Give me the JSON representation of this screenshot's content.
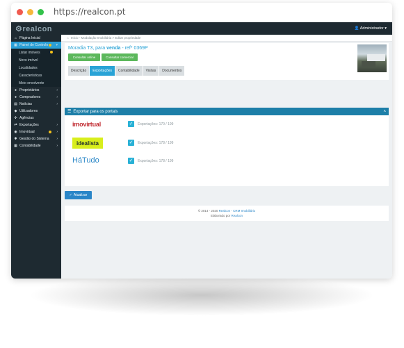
{
  "browser": {
    "url": "https://realcon.pt",
    "dots": [
      "#f05a4f",
      "#f6b73c",
      "#33c24a"
    ]
  },
  "app": {
    "logo": "realcon",
    "user": "Administrador",
    "sidebar": [
      {
        "label": "Página Inicial",
        "icon": "home-icon",
        "type": "item"
      },
      {
        "label": "Painel de Controlo",
        "icon": "dashboard-icon",
        "type": "item",
        "active": true,
        "dot": true
      },
      {
        "label": "Listar imóveis",
        "type": "sub",
        "dot": true
      },
      {
        "label": "Novo imóvel",
        "type": "sub"
      },
      {
        "label": "Localidades",
        "type": "sub"
      },
      {
        "label": "Características",
        "type": "sub"
      },
      {
        "label": "Meio envolvente",
        "type": "sub"
      },
      {
        "label": "Proprietários",
        "icon": "user-icon",
        "type": "item"
      },
      {
        "label": "Compradores",
        "icon": "user-icon",
        "type": "item"
      },
      {
        "label": "Notícias",
        "icon": "news-icon",
        "type": "item"
      },
      {
        "label": "Utilizadores",
        "icon": "users-icon",
        "type": "item"
      },
      {
        "label": "Agências",
        "icon": "agency-icon",
        "type": "item"
      },
      {
        "label": "Exportações",
        "icon": "export-icon",
        "type": "item"
      },
      {
        "label": "Imovirtual",
        "icon": "imovirtual-icon",
        "type": "item",
        "dot": true
      },
      {
        "label": "Gestão do Sistema",
        "icon": "gear-icon",
        "type": "item"
      },
      {
        "label": "Contabilidade",
        "icon": "grid-icon",
        "type": "item"
      }
    ],
    "breadcrumb": "Início - Modulação Imobiliária > Editar propriedade",
    "property": {
      "title_prefix": "Moradia T3, para",
      "title_mode": "venda",
      "title_ref": "- ref* 0369P",
      "btn_online": "Consultar online",
      "btn_comercial": "Consultar comercial"
    },
    "tabs": [
      "Descrição",
      "Exportações",
      "Contabilidade",
      "Visitas",
      "Documentos"
    ],
    "active_tab": 1,
    "portals": {
      "header": "Exportar para os portais",
      "rows": [
        {
          "name": "imovirtual",
          "exports": "Exportações: 170 / 199"
        },
        {
          "name": "idealista",
          "exports": "Exportações: 178 / 199"
        },
        {
          "name": "HáTudo",
          "exports": "Exportações: 178 / 199"
        }
      ]
    },
    "update_button": "Atualizar",
    "footer": {
      "line1_prefix": "© 2014 - 2020",
      "line1_link": "Realcon - CRM Imobiliário",
      "line2_prefix": "Elaborado por",
      "line2_link": "Realcon"
    }
  }
}
